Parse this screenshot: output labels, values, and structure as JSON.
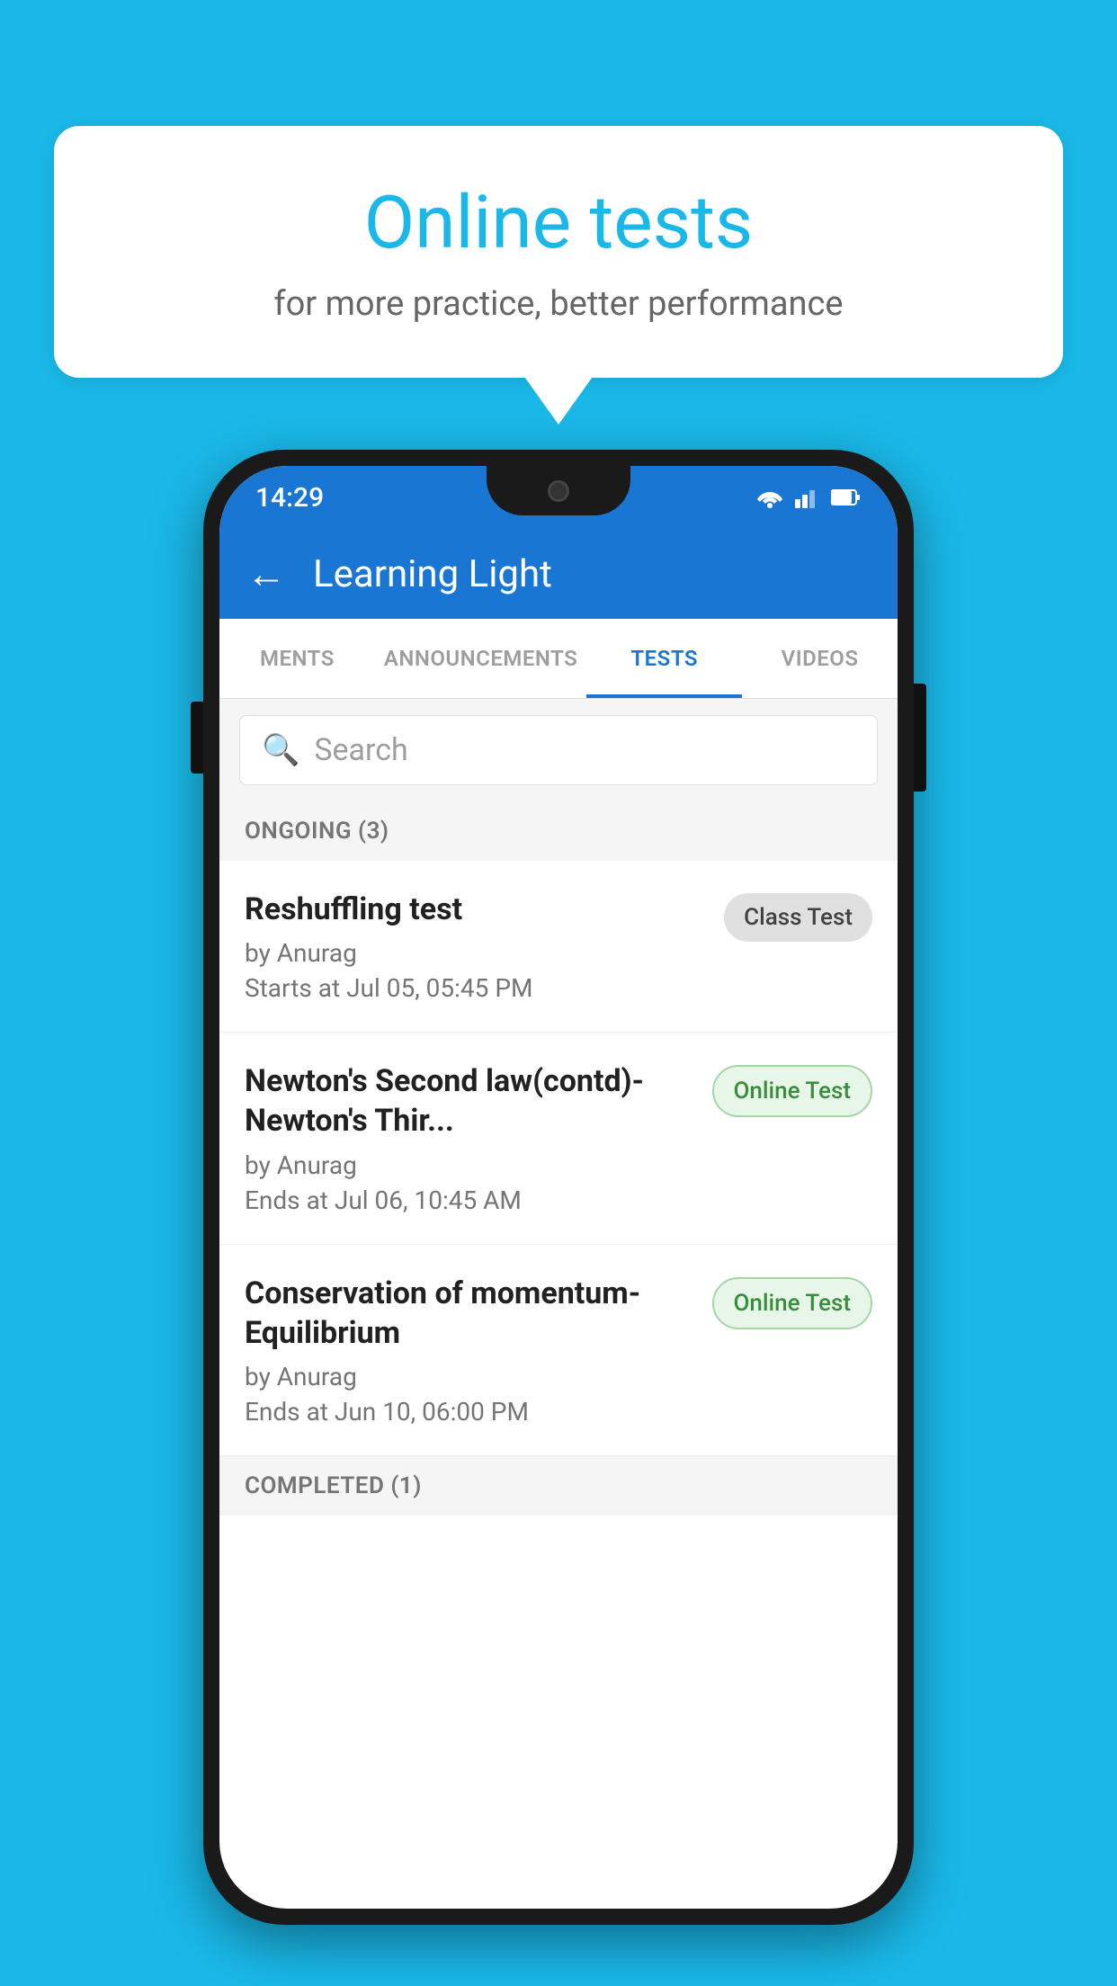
{
  "background_color": "#1ab8e8",
  "speech_bubble": {
    "title": "Online tests",
    "subtitle": "for more practice, better performance"
  },
  "phone": {
    "status_bar": {
      "time": "14:29"
    },
    "app_bar": {
      "title": "Learning Light",
      "back_label": "←"
    },
    "tabs": [
      {
        "label": "MENTS",
        "active": false
      },
      {
        "label": "ANNOUNCEMENTS",
        "active": false
      },
      {
        "label": "TESTS",
        "active": true
      },
      {
        "label": "VIDEOS",
        "active": false
      }
    ],
    "search": {
      "placeholder": "Search"
    },
    "sections": [
      {
        "header": "ONGOING (3)",
        "items": [
          {
            "title": "Reshuffling test",
            "author": "by Anurag",
            "date": "Starts at  Jul 05, 05:45 PM",
            "badge": "Class Test",
            "badge_type": "class"
          },
          {
            "title": "Newton's Second law(contd)-Newton's Thir...",
            "author": "by Anurag",
            "date": "Ends at  Jul 06, 10:45 AM",
            "badge": "Online Test",
            "badge_type": "online"
          },
          {
            "title": "Conservation of momentum-Equilibrium",
            "author": "by Anurag",
            "date": "Ends at  Jun 10, 06:00 PM",
            "badge": "Online Test",
            "badge_type": "online"
          }
        ]
      }
    ],
    "completed_section_header": "COMPLETED (1)"
  }
}
